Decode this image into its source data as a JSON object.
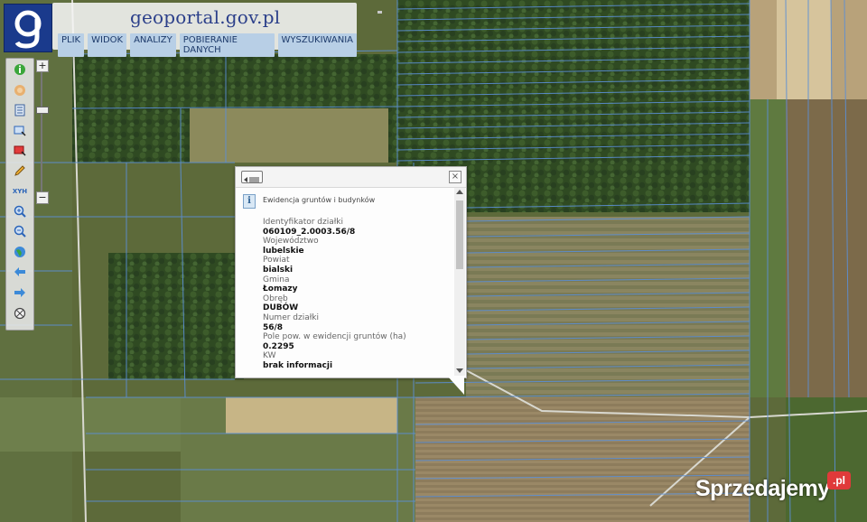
{
  "header": {
    "brand": "geoportal.gov.pl",
    "menu": [
      "PLIK",
      "WIDOK",
      "ANALIZY",
      "POBIERANIE DANYCH",
      "WYSZUKIWANIA"
    ]
  },
  "toolbar": {
    "tools": [
      "info-icon",
      "hand-icon",
      "layers-icon",
      "select-area-icon",
      "select-red-icon",
      "pencil-icon",
      "xyz-icon",
      "zoom-in-icon",
      "zoom-out-icon",
      "globe-icon",
      "arrow-left-icon",
      "arrow-right-icon",
      "compass-icon"
    ],
    "xyz_label": "XYH"
  },
  "zoom": {
    "plus": "+",
    "minus": "−"
  },
  "popup": {
    "title": "Ewidencja gruntów i budynków",
    "fields": [
      {
        "label": "Identyfikator działki",
        "value": "060109_2.0003.56/8"
      },
      {
        "label": "Województwo",
        "value": "lubelskie"
      },
      {
        "label": "Powiat",
        "value": "bialski"
      },
      {
        "label": "Gmina",
        "value": "Łomazy"
      },
      {
        "label": "Obręb",
        "value": "DUBÓW"
      },
      {
        "label": "Numer działki",
        "value": "56/8"
      },
      {
        "label": "Pole pow. w ewidencji gruntów (ha)",
        "value": "0.2295"
      },
      {
        "label": "KW",
        "value": "brak informacji"
      }
    ],
    "close": "×"
  },
  "watermark": {
    "text": "Sprzedajemy",
    "badge": ".pl"
  },
  "colors": {
    "parcel_lines": "#5b8fd6",
    "logo_bg": "#1a3a8c",
    "menu_bg": "#b8cfe6"
  }
}
